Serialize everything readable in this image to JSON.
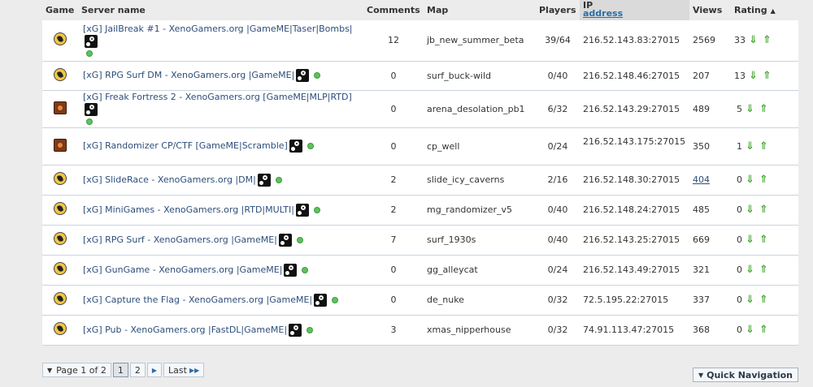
{
  "columns": {
    "game": "Game",
    "server_name": "Server name",
    "comments": "Comments",
    "map": "Map",
    "players": "Players",
    "ip_line1": "IP",
    "ip_line2": "address",
    "views": "Views",
    "rating": "Rating"
  },
  "servers": [
    {
      "game": "cs-icon",
      "name": "[xG] JailBreak #1 - XenoGamers.org |GameME|Taser|Bombs|",
      "comments": "12",
      "map": "jb_new_summer_beta",
      "players": "39/64",
      "ip": "216.52.143.83:27015",
      "views": "2569",
      "rating": "33"
    },
    {
      "game": "cs-icon",
      "name": "[xG] RPG Surf DM - XenoGamers.org |GameME|",
      "comments": "0",
      "map": "surf_buck-wild",
      "players": "0/40",
      "ip": "216.52.148.46:27015",
      "views": "207",
      "rating": "13"
    },
    {
      "game": "tf-icon",
      "name": "[xG] Freak Fortress 2 - XenoGamers.org [GameME|MLP|RTD]",
      "comments": "0",
      "map": "arena_desolation_pb1",
      "players": "6/32",
      "ip": "216.52.143.29:27015",
      "views": "489",
      "rating": "5"
    },
    {
      "game": "tf-icon",
      "name": "[xG] Randomizer CP/CTF [GameME|Scramble]",
      "comments": "0",
      "map": "cp_well",
      "players": "0/24",
      "ip": "216.52.143.175:27015",
      "views": "350",
      "rating": "1"
    },
    {
      "game": "cs-icon",
      "name": "[xG] SlideRace - XenoGamers.org |DM|",
      "comments": "2",
      "map": "slide_icy_caverns",
      "players": "2/16",
      "ip": "216.52.148.30:27015",
      "views": "404",
      "rating": "0"
    },
    {
      "game": "cs-icon",
      "name": "[xG] MiniGames - XenoGamers.org |RTD|MULTI|",
      "comments": "2",
      "map": "mg_randomizer_v5",
      "players": "0/40",
      "ip": "216.52.148.24:27015",
      "views": "485",
      "rating": "0"
    },
    {
      "game": "cs-icon",
      "name": "[xG] RPG Surf - XenoGamers.org |GameME|",
      "comments": "7",
      "map": "surf_1930s",
      "players": "0/40",
      "ip": "216.52.143.25:27015",
      "views": "669",
      "rating": "0"
    },
    {
      "game": "cs-icon",
      "name": "[xG] GunGame - XenoGamers.org |GameME|",
      "comments": "0",
      "map": "gg_alleycat",
      "players": "0/24",
      "ip": "216.52.143.49:27015",
      "views": "321",
      "rating": "0"
    },
    {
      "game": "cs-icon",
      "name": "[xG] Capture the Flag - XenoGamers.org |GameME|",
      "comments": "0",
      "map": "de_nuke",
      "players": "0/32",
      "ip": "72.5.195.22:27015",
      "views": "337",
      "rating": "0"
    },
    {
      "game": "cs-icon",
      "name": "[xG] Pub - XenoGamers.org |FastDL|GameME|",
      "comments": "3",
      "map": "xmas_nipperhouse",
      "players": "0/32",
      "ip": "74.91.113.47:27015",
      "views": "368",
      "rating": "0"
    }
  ],
  "pager": {
    "page_label": "Page 1 of 2",
    "page1": "1",
    "page2": "2",
    "last_label": "Last"
  },
  "quick_nav": "Quick Navigation",
  "colors": {
    "link": "#2d4d7a",
    "online": "#5ec15e",
    "rating_arrow": "#4caa3a"
  }
}
